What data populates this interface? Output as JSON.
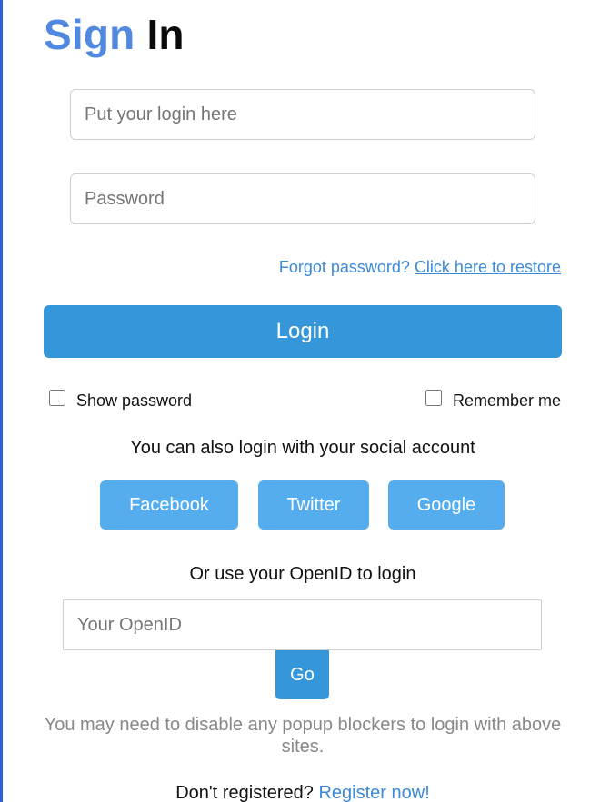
{
  "title": {
    "word_accent": "Sign",
    "word_main": "In"
  },
  "form": {
    "login_placeholder": "Put your login here",
    "password_placeholder": "Password",
    "forgot_text": "Forgot password?",
    "restore_link": "Click here to restore",
    "login_button": "Login",
    "show_password_label": "Show password",
    "remember_me_label": "Remember me",
    "show_password_checked": false,
    "remember_me_checked": false
  },
  "social": {
    "heading": "You can also login with your social account",
    "buttons": [
      "Facebook",
      "Twitter",
      "Google"
    ]
  },
  "openid": {
    "heading": "Or use your OpenID to login",
    "placeholder": "Your OpenID",
    "go_button": "Go"
  },
  "notes": {
    "popup_note": "You may need to disable any popup blockers to login with above sites.",
    "register_prompt": "Don't registered?",
    "register_link": "Register now!"
  },
  "colors": {
    "accent_blue": "#5189e0",
    "primary_button": "#3596da",
    "social_button": "#55adee",
    "link": "#3b8ad6",
    "muted_text": "#888888",
    "left_border": "#2f63d6"
  }
}
